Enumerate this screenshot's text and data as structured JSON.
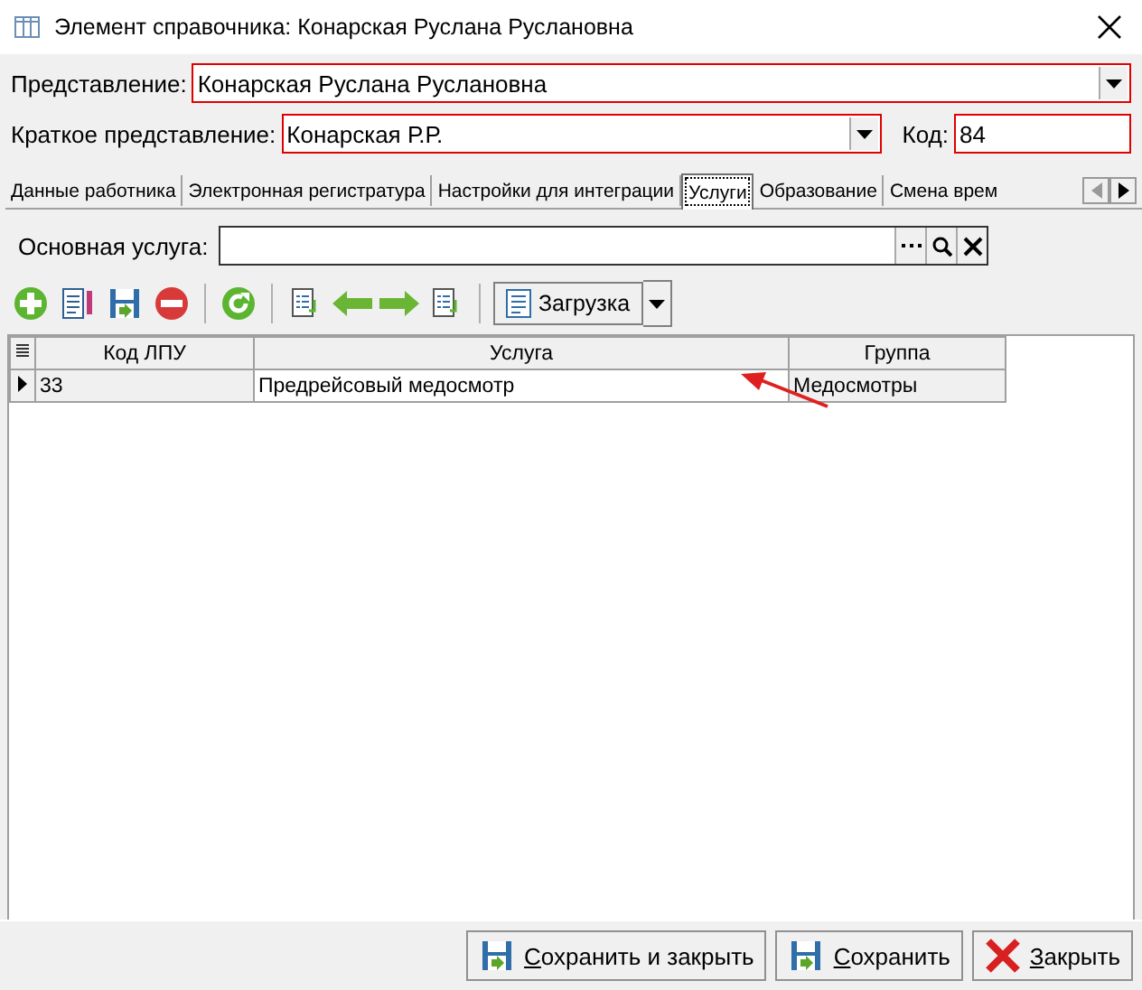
{
  "window": {
    "title": "Элемент справочника: Конарская Руслана Руслановна"
  },
  "presentation": {
    "label": "Представление:",
    "value": "Конарская Руслана Руслановна"
  },
  "short_presentation": {
    "label": "Краткое представление:",
    "value": "Конарская Р.Р."
  },
  "code": {
    "label": "Код:",
    "value": "84"
  },
  "tabs": [
    {
      "label": "Данные работника",
      "selected": false
    },
    {
      "label": "Электронная регистратура",
      "selected": false
    },
    {
      "label": "Настройки для интеграции",
      "selected": false
    },
    {
      "label": "Услуги",
      "selected": true
    },
    {
      "label": "Образование",
      "selected": false
    },
    {
      "label": "Смена врем",
      "selected": false
    }
  ],
  "main_service": {
    "label": "Основная услуга:"
  },
  "toolbar": [
    {
      "kind": "add"
    },
    {
      "kind": "edit"
    },
    {
      "kind": "save"
    },
    {
      "kind": "delete"
    },
    {
      "kind": "sep"
    },
    {
      "kind": "refresh"
    },
    {
      "kind": "sep"
    },
    {
      "kind": "list"
    },
    {
      "kind": "left"
    },
    {
      "kind": "right"
    },
    {
      "kind": "list"
    },
    {
      "kind": "sep"
    }
  ],
  "load_button": {
    "label": "Загрузка"
  },
  "table": {
    "columns": [
      "Код ЛПУ",
      "Услуга",
      "Группа"
    ],
    "rows": [
      {
        "cells": [
          "33",
          "Предрейсовый медосмотр",
          "Медосмотры"
        ],
        "selected": true
      }
    ]
  },
  "footer_buttons": [
    {
      "kind": "save_close",
      "label": "Сохранить и закрыть"
    },
    {
      "kind": "save",
      "label": "Сохранить"
    },
    {
      "kind": "close",
      "label": "Закрыть"
    }
  ]
}
